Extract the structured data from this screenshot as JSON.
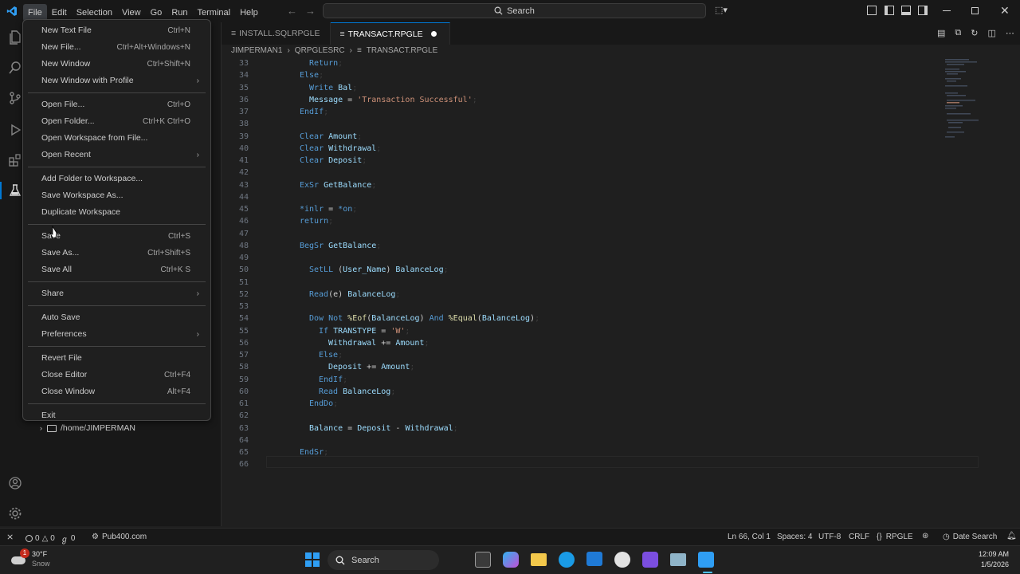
{
  "menubar": [
    "File",
    "Edit",
    "Selection",
    "View",
    "Go",
    "Run",
    "Terminal",
    "Help"
  ],
  "search_label": "Search",
  "tabs": [
    {
      "label": "INSTALL.SQLRPGLE",
      "active": false
    },
    {
      "label": "TRANSACT.RPGLE",
      "active": true,
      "modified": true
    }
  ],
  "breadcrumb": [
    "JIMPERMAN1",
    "QRPGLESRC",
    "TRANSACT.RPGLE"
  ],
  "file_menu": {
    "groups": [
      [
        {
          "label": "New Text File",
          "shortcut": "Ctrl+N"
        },
        {
          "label": "New File...",
          "shortcut": "Ctrl+Alt+Windows+N"
        },
        {
          "label": "New Window",
          "shortcut": "Ctrl+Shift+N"
        },
        {
          "label": "New Window with Profile",
          "submenu": true
        }
      ],
      [
        {
          "label": "Open File...",
          "shortcut": "Ctrl+O"
        },
        {
          "label": "Open Folder...",
          "shortcut": "Ctrl+K Ctrl+O"
        },
        {
          "label": "Open Workspace from File..."
        },
        {
          "label": "Open Recent",
          "submenu": true
        }
      ],
      [
        {
          "label": "Add Folder to Workspace..."
        },
        {
          "label": "Save Workspace As..."
        },
        {
          "label": "Duplicate Workspace"
        }
      ],
      [
        {
          "label": "Save",
          "shortcut": "Ctrl+S"
        },
        {
          "label": "Save As...",
          "shortcut": "Ctrl+Shift+S"
        },
        {
          "label": "Save All",
          "shortcut": "Ctrl+K S"
        }
      ],
      [
        {
          "label": "Share",
          "submenu": true
        }
      ],
      [
        {
          "label": "Auto Save"
        },
        {
          "label": "Preferences",
          "submenu": true
        }
      ],
      [
        {
          "label": "Revert File"
        },
        {
          "label": "Close Editor",
          "shortcut": "Ctrl+F4"
        },
        {
          "label": "Close Window",
          "shortcut": "Alt+F4"
        }
      ],
      [
        {
          "label": "Exit"
        }
      ]
    ]
  },
  "sidebar_tree_item": "/home/JIMPERMAN",
  "code_lines": [
    {
      "n": 33,
      "indent": 1,
      "tokens": [
        [
          "kw",
          "Return"
        ],
        [
          "semi",
          ";"
        ]
      ]
    },
    {
      "n": 34,
      "indent": 0,
      "tokens": [
        [
          "kw",
          "Else"
        ],
        [
          "semi",
          ";"
        ]
      ]
    },
    {
      "n": 35,
      "indent": 1,
      "tokens": [
        [
          "kw",
          "Write "
        ],
        [
          "id",
          "Bal"
        ],
        [
          "semi",
          ";"
        ]
      ]
    },
    {
      "n": 36,
      "indent": 1,
      "tokens": [
        [
          "id",
          "Message"
        ],
        [
          "pn",
          " = "
        ],
        [
          "str",
          "'Transaction Successful'"
        ],
        [
          "semi",
          ";"
        ]
      ]
    },
    {
      "n": 37,
      "indent": 0,
      "tokens": [
        [
          "kw",
          "EndIf"
        ],
        [
          "semi",
          ";"
        ]
      ]
    },
    {
      "n": 38,
      "indent": 0,
      "tokens": []
    },
    {
      "n": 39,
      "indent": 0,
      "tokens": [
        [
          "kw",
          "Clear "
        ],
        [
          "id",
          "Amount"
        ],
        [
          "semi",
          ";"
        ]
      ]
    },
    {
      "n": 40,
      "indent": 0,
      "tokens": [
        [
          "kw",
          "Clear "
        ],
        [
          "id",
          "Withdrawal"
        ],
        [
          "semi",
          ";"
        ]
      ]
    },
    {
      "n": 41,
      "indent": 0,
      "tokens": [
        [
          "kw",
          "Clear "
        ],
        [
          "id",
          "Deposit"
        ],
        [
          "semi",
          ";"
        ]
      ]
    },
    {
      "n": 42,
      "indent": 0,
      "tokens": []
    },
    {
      "n": 43,
      "indent": 0,
      "tokens": [
        [
          "kw",
          "ExSr "
        ],
        [
          "id",
          "GetBalance"
        ],
        [
          "semi",
          ";"
        ]
      ]
    },
    {
      "n": 44,
      "indent": 0,
      "tokens": []
    },
    {
      "n": 45,
      "indent": 0,
      "tokens": [
        [
          "kw",
          "*inlr"
        ],
        [
          "pn",
          " = "
        ],
        [
          "kw",
          "*on"
        ],
        [
          "semi",
          ";"
        ]
      ]
    },
    {
      "n": 46,
      "indent": 0,
      "tokens": [
        [
          "kw",
          "return"
        ],
        [
          "semi",
          ";"
        ]
      ]
    },
    {
      "n": 47,
      "indent": 0,
      "tokens": []
    },
    {
      "n": 48,
      "indent": 0,
      "tokens": [
        [
          "kw",
          "BegSr "
        ],
        [
          "id",
          "GetBalance"
        ],
        [
          "semi",
          ";"
        ]
      ]
    },
    {
      "n": 49,
      "indent": 0,
      "tokens": []
    },
    {
      "n": 50,
      "indent": 1,
      "tokens": [
        [
          "kw",
          "SetLL "
        ],
        [
          "pn",
          "("
        ],
        [
          "id",
          "User_Name"
        ],
        [
          "pn",
          ") "
        ],
        [
          "id",
          "BalanceLog"
        ],
        [
          "semi",
          ";"
        ]
      ]
    },
    {
      "n": 51,
      "indent": 0,
      "tokens": []
    },
    {
      "n": 52,
      "indent": 1,
      "tokens": [
        [
          "kw",
          "Read"
        ],
        [
          "pn",
          "(e) "
        ],
        [
          "id",
          "BalanceLog"
        ],
        [
          "semi",
          ";"
        ]
      ]
    },
    {
      "n": 53,
      "indent": 0,
      "tokens": []
    },
    {
      "n": 54,
      "indent": 1,
      "tokens": [
        [
          "kw",
          "Dow Not "
        ],
        [
          "fn",
          "%Eof"
        ],
        [
          "pn",
          "("
        ],
        [
          "id",
          "BalanceLog"
        ],
        [
          "pn",
          ") "
        ],
        [
          "kw",
          "And "
        ],
        [
          "fn",
          "%Equal"
        ],
        [
          "pn",
          "("
        ],
        [
          "id",
          "BalanceLog"
        ],
        [
          "pn",
          ")"
        ],
        [
          "semi",
          ";"
        ]
      ]
    },
    {
      "n": 55,
      "indent": 2,
      "tokens": [
        [
          "kw",
          "If "
        ],
        [
          "id",
          "TRANSTYPE"
        ],
        [
          "pn",
          " = "
        ],
        [
          "str",
          "'W'"
        ],
        [
          "semi",
          ";"
        ]
      ]
    },
    {
      "n": 56,
      "indent": 3,
      "tokens": [
        [
          "id",
          "Withdrawal"
        ],
        [
          "pn",
          " += "
        ],
        [
          "id",
          "Amount"
        ],
        [
          "semi",
          ";"
        ]
      ]
    },
    {
      "n": 57,
      "indent": 2,
      "tokens": [
        [
          "kw",
          "Else"
        ],
        [
          "semi",
          ";"
        ]
      ]
    },
    {
      "n": 58,
      "indent": 3,
      "tokens": [
        [
          "id",
          "Deposit"
        ],
        [
          "pn",
          " += "
        ],
        [
          "id",
          "Amount"
        ],
        [
          "semi",
          ";"
        ]
      ]
    },
    {
      "n": 59,
      "indent": 2,
      "tokens": [
        [
          "kw",
          "EndIf"
        ],
        [
          "semi",
          ";"
        ]
      ]
    },
    {
      "n": 60,
      "indent": 2,
      "tokens": [
        [
          "kw",
          "Read "
        ],
        [
          "id",
          "BalanceLog"
        ],
        [
          "semi",
          ";"
        ]
      ]
    },
    {
      "n": 61,
      "indent": 1,
      "tokens": [
        [
          "kw",
          "EndDo"
        ],
        [
          "semi",
          ";"
        ]
      ]
    },
    {
      "n": 62,
      "indent": 0,
      "tokens": []
    },
    {
      "n": 63,
      "indent": 1,
      "tokens": [
        [
          "id",
          "Balance"
        ],
        [
          "pn",
          " = "
        ],
        [
          "id",
          "Deposit"
        ],
        [
          "pn",
          " - "
        ],
        [
          "id",
          "Withdrawal"
        ],
        [
          "semi",
          ";"
        ]
      ]
    },
    {
      "n": 64,
      "indent": 0,
      "tokens": []
    },
    {
      "n": 65,
      "indent": 0,
      "tokens": [
        [
          "kw",
          "EndSr"
        ],
        [
          "semi",
          ";"
        ]
      ]
    },
    {
      "n": 66,
      "indent": 0,
      "tokens": []
    }
  ],
  "statusbar": {
    "errors": "0",
    "warnings": "0",
    "ports": "0",
    "connection": "Pub400.com",
    "position": "Ln 66, Col 1",
    "spaces": "Spaces: 4",
    "encoding": "UTF-8",
    "eol": "CRLF",
    "language": "RPGLE",
    "date_search": "Date Search"
  },
  "taskbar": {
    "weather_temp": "30°F",
    "weather_desc": "Snow",
    "weather_badge": "1",
    "search": "Search",
    "time": "12:09 AM",
    "date": "1/5/2026"
  },
  "colors": {
    "accent": "#0078d4",
    "keyword": "#569cd6",
    "identifier": "#9cdcfe",
    "string": "#ce9178"
  }
}
